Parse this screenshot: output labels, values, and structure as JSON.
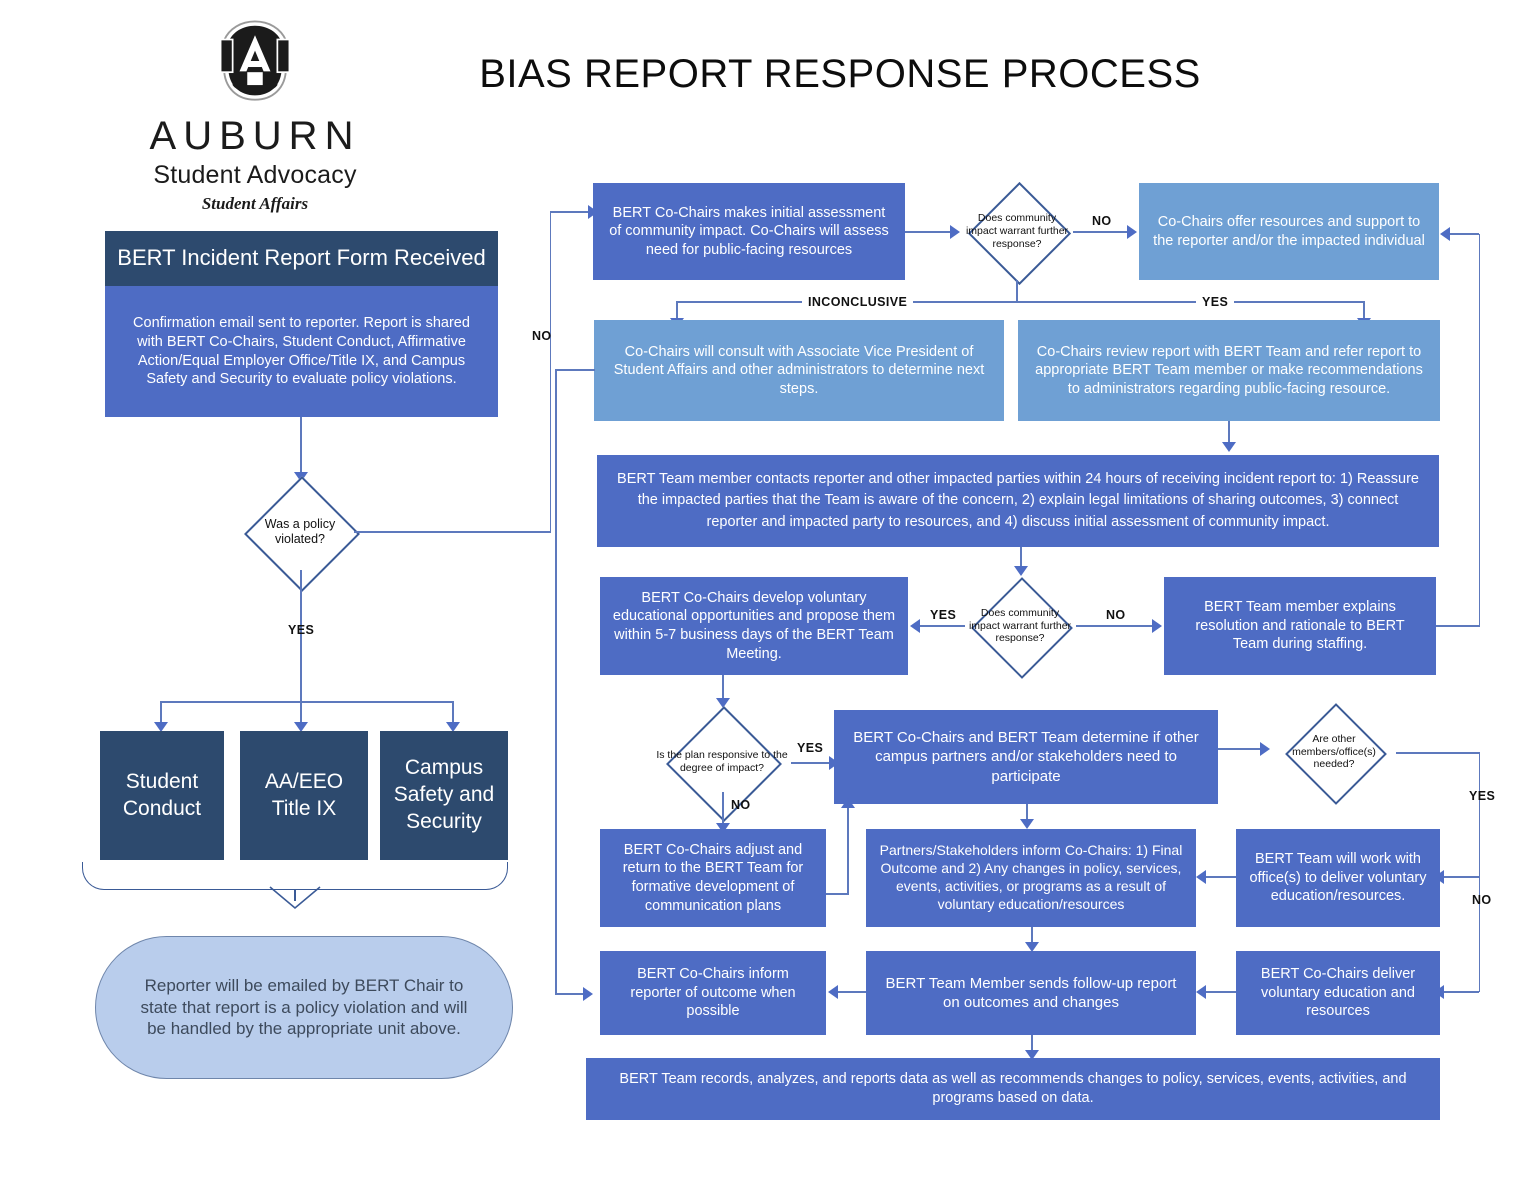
{
  "page": {
    "title": "BIAS REPORT RESPONSE PROCESS",
    "colors": {
      "navy": "#2d4a6e",
      "mid_blue": "#4e6cc4",
      "light_blue": "#6fa0d4",
      "pill_blue": "#b9cdec",
      "connector": "#5d79bd",
      "diamond_border": "#3a5a96"
    }
  },
  "logo": {
    "mark": "auburn-au-logo",
    "wordmark": "AUBURN",
    "line2": "Student Advocacy",
    "line3": "Student Affairs"
  },
  "nodes": {
    "intake_header": "BERT Incident Report Form Received",
    "intake_body": "Confirmation email sent to reporter. Report is shared with BERT Co-Chairs, Student Conduct, Affirmative Action/Equal Employer Office/Title IX, and Campus Safety and Security to evaluate policy violations.",
    "d_policy": "Was a policy violated?",
    "unit_1": "Student Conduct",
    "unit_2": "AA/EEO Title IX",
    "unit_3": "Campus Safety and Security",
    "pill_note": "Reporter will be emailed by BERT Chair to state that report is a policy violation and will be handled by the appropriate unit above.",
    "initial_assessment": "BERT Co-Chairs makes initial assessment of community impact. Co-Chairs will assess need for public-facing resources",
    "d_impact_1": "Does community impact warrant further response?",
    "offer_resources": "Co-Chairs offer resources and support to the reporter and/or the impacted individual",
    "consult_avp": "Co-Chairs will consult with Associate Vice President of Student Affairs and other administrators to determine next steps.",
    "review_refer": "Co-Chairs review report with BERT Team and refer report to appropriate BERT Team member or make recommendations to administrators regarding public-facing resource.",
    "contact_24h": "BERT Team member contacts reporter and other impacted parties within 24 hours of receiving incident report to: 1) Reassure the impacted parties that the Team is aware of the concern, 2) explain legal limitations of sharing outcomes, 3) connect reporter and impacted party to resources, and 4) discuss initial assessment of community impact.",
    "develop_voluntary": "BERT Co-Chairs develop voluntary educational opportunities and propose them within 5-7 business days of the BERT Team Meeting.",
    "d_impact_2": "Does community impact warrant further response?",
    "explain_resolution": "BERT Team member explains resolution and rationale to BERT Team during staffing.",
    "d_plan": "Is the plan responsive to the degree of impact?",
    "determine_partners": "BERT Co-Chairs and BERT Team determine if other campus partners and/or stakeholders need to participate",
    "d_members": "Are other members/office(s) needed?",
    "adjust_return": "BERT Co-Chairs adjust and return to the BERT Team for formative development of communication plans",
    "partners_inform": "Partners/Stakeholders inform Co-Chairs: 1) Final Outcome and 2) Any changes in policy, services, events, activities, or programs as a result of voluntary education/resources",
    "team_work_offices": "BERT Team will work with office(s) to deliver voluntary education/resources.",
    "inform_reporter": "BERT Co-Chairs inform reporter of outcome when possible",
    "followup_report": "BERT Team Member sends follow-up report on outcomes and changes",
    "cochairs_deliver": "BERT Co-Chairs deliver voluntary education and resources",
    "records_analyzes": "BERT Team records, analyzes, and reports data as well as recommends changes to policy, services, events, activities, and programs based on data."
  },
  "edge_labels": {
    "no_policy": "NO",
    "yes_policy": "YES",
    "no_impact1": "NO",
    "yes_impact1": "YES",
    "inconclusive": "INCONCLUSIVE",
    "yes_impact2": "YES",
    "no_impact2": "NO",
    "yes_plan": "YES",
    "no_plan": "NO",
    "yes_members": "YES",
    "no_members": "NO"
  }
}
